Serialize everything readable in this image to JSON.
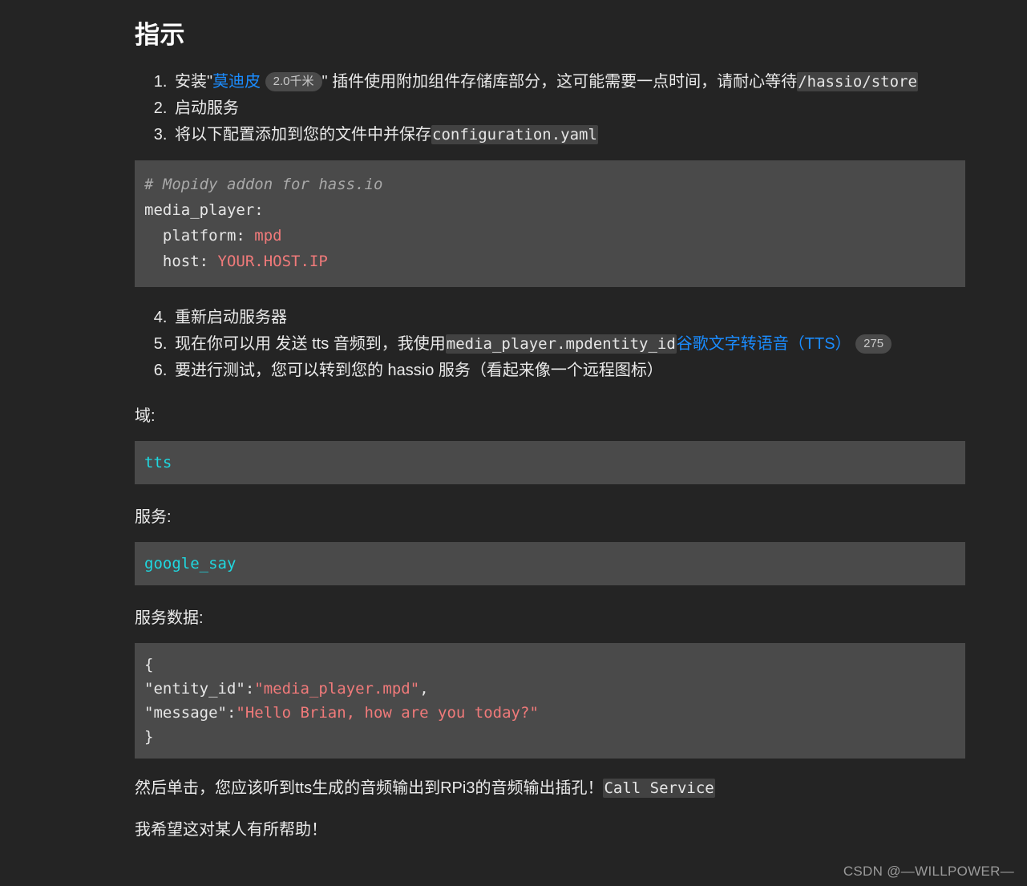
{
  "page": {
    "background_color": "#242424",
    "text_color": "#eaeaea",
    "link_color": "#1a8cff",
    "code_block_bg": "#4a4a4a",
    "inline_code_bg": "#424242",
    "accent_cyan": "#1fd8e0",
    "accent_red": "#f07a7a"
  },
  "title": "指示",
  "steps": [
    {
      "num": "1.",
      "text_before_link": "安装\"",
      "link_label": "莫迪皮",
      "badge": "2.0千米",
      "text_after_badge": "\" 插件使用附加组件存储库部分，这可能需要一点时间，请耐心等待",
      "inline_code": "/hassio/store"
    },
    {
      "num": "2.",
      "text": "启动服务"
    },
    {
      "num": "3.",
      "text": "将以下配置添加到您的文件中并保存",
      "inline_code": "configuration.yaml"
    }
  ],
  "code_block_yaml": {
    "lines": [
      {
        "type": "comment",
        "text": "# Mopidy addon for hass.io"
      },
      {
        "type": "key",
        "text": "media_player:"
      },
      {
        "type": "kv",
        "key": "  platform: ",
        "value": "mpd"
      },
      {
        "type": "kv",
        "key": "  host: ",
        "value": "YOUR.HOST.IP"
      }
    ]
  },
  "steps_continued": [
    {
      "num": "4.",
      "text": "重新启动服务器"
    },
    {
      "num": "5.",
      "text_before": "现在你可以用 发送 tts 音频到，我使用",
      "inline_code": "media_player.mpdentity_id",
      "link_label": "谷歌文字转语音（TTS）",
      "badge": "275"
    },
    {
      "num": "6.",
      "text": "要进行测试，您可以转到您的 hassio 服务（看起来像一个远程图标）"
    }
  ],
  "sections": [
    {
      "label": "域:",
      "code": "tts",
      "code_color": "cyan"
    },
    {
      "label": "服务:",
      "code": "google_say",
      "code_color": "cyan"
    }
  ],
  "service_data": {
    "label": "服务数据:",
    "lines": [
      {
        "segments": [
          {
            "cls": "punct",
            "text": "{"
          }
        ]
      },
      {
        "segments": [
          {
            "cls": "punct",
            "text": "\"entity_id\":"
          },
          {
            "cls": "str",
            "text": "\"media_player.mpd\""
          },
          {
            "cls": "punct",
            "text": ","
          }
        ]
      },
      {
        "segments": [
          {
            "cls": "punct",
            "text": "\"message\":"
          },
          {
            "cls": "str",
            "text": "\"Hello Brian, how are you today?\""
          }
        ]
      },
      {
        "segments": [
          {
            "cls": "punct",
            "text": "}"
          }
        ]
      }
    ]
  },
  "closing": {
    "text_before": "然后单击，您应该听到tts生成的音频输出到RPi3的音频输出插孔！",
    "inline_code": "Call Service",
    "final_line": "我希望这对某人有所帮助！"
  },
  "watermark": "CSDN @—WILLPOWER—"
}
